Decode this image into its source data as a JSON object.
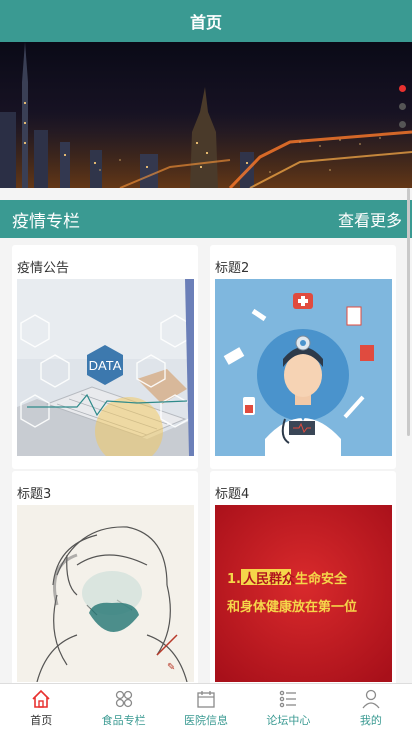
{
  "header": {
    "title": "首页"
  },
  "banner": {
    "slides": 3,
    "active_index": 0
  },
  "section": {
    "title": "疫情专栏",
    "more": "查看更多"
  },
  "cards": [
    {
      "title": "疫情公告",
      "image": "data-laptop-image"
    },
    {
      "title": "标题2",
      "image": "doctor-illustration"
    },
    {
      "title": "标题3",
      "image": "masked-worker-sketch"
    },
    {
      "title": "标题4",
      "image": "red-slogan-poster"
    }
  ],
  "images": {
    "data_label": "DATA",
    "poster_line1_pre": "1.把",
    "poster_line1_hl": "人民群众",
    "poster_line1_post": "生命安全",
    "poster_line2": "和身体健康放在第一位"
  },
  "tabs": [
    {
      "label": "首页",
      "icon": "home-icon",
      "active": true
    },
    {
      "label": "食品专栏",
      "icon": "grid-icon",
      "active": false
    },
    {
      "label": "医院信息",
      "icon": "calendar-icon",
      "active": false
    },
    {
      "label": "论坛中心",
      "icon": "list-icon",
      "active": false
    },
    {
      "label": "我的",
      "icon": "user-icon",
      "active": false
    }
  ],
  "colors": {
    "primary": "#3a9a92",
    "accent": "#e8312f"
  }
}
